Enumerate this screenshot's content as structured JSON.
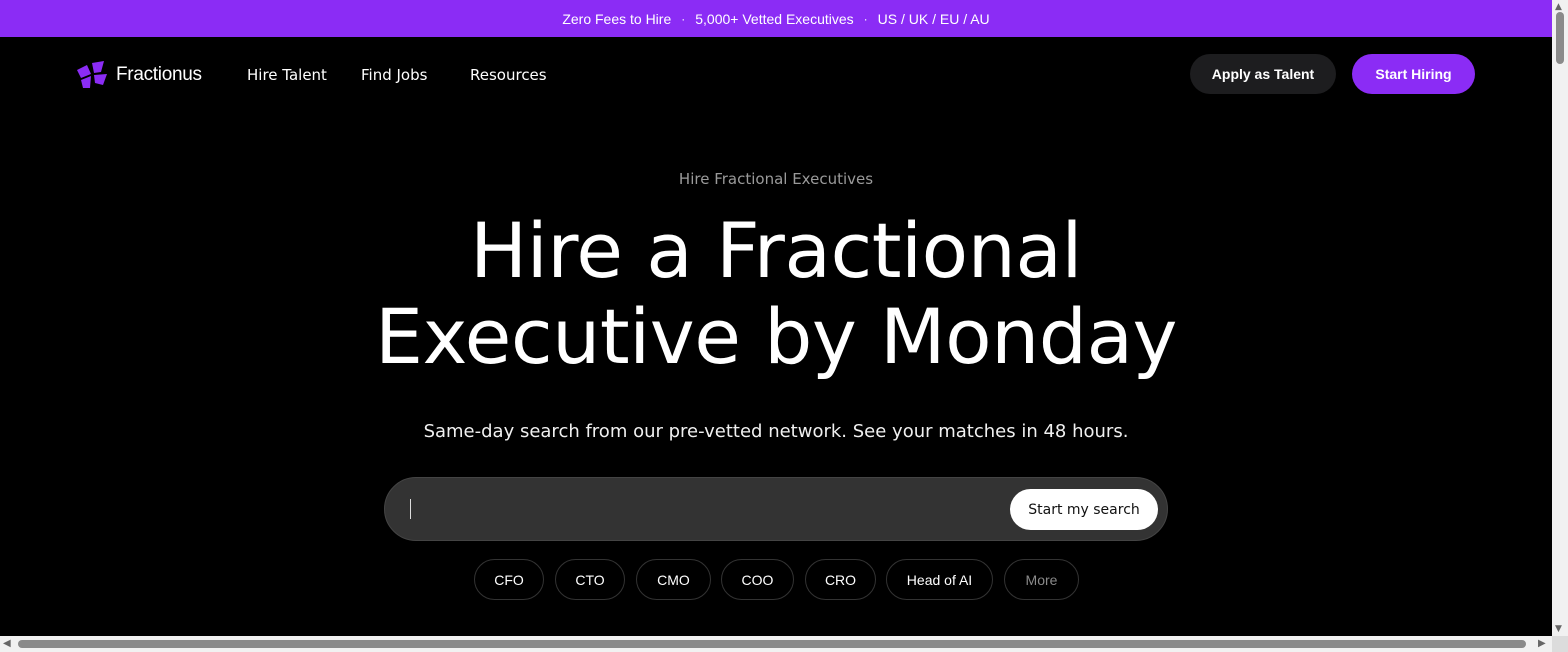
{
  "announcement": {
    "items": [
      "Zero Fees to Hire",
      "5,000+ Vetted Executives",
      "US / UK / EU / AU"
    ],
    "separator": "·"
  },
  "nav": {
    "brand": "Fractionus",
    "links": [
      "Hire Talent",
      "Find Jobs",
      "Resources"
    ],
    "apply_label": "Apply as Talent",
    "start_hiring_label": "Start Hiring"
  },
  "hero": {
    "eyebrow": "Hire Fractional Executives",
    "headline_line1": "Hire a Fractional",
    "headline_line2": "Executive by Monday",
    "subheadline": "Same-day search from our pre-vetted network. See your matches in 48 hours."
  },
  "search": {
    "value": "",
    "button_label": "Start my search"
  },
  "roles": [
    "CFO",
    "CTO",
    "CMO",
    "COO",
    "CRO",
    "Head of AI",
    "More"
  ],
  "colors": {
    "brand_purple": "#8b2cf5",
    "background": "#000000",
    "search_bg": "#333333"
  }
}
